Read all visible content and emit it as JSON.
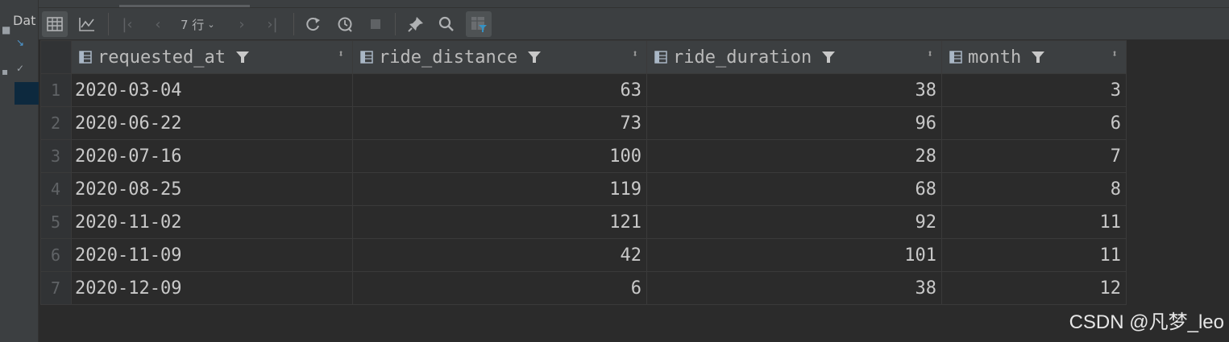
{
  "left_panel": {
    "truncated_label": "Dat"
  },
  "toolbar": {
    "rows_label": "7 行",
    "icons": [
      "table-view-icon",
      "chart-view-icon",
      "first-page-icon",
      "prev-page-icon",
      "next-page-icon",
      "last-page-icon",
      "refresh-icon",
      "history-icon",
      "stop-icon",
      "pin-icon",
      "search-icon",
      "filter-toggle-icon"
    ]
  },
  "table": {
    "columns": [
      {
        "label": "requested_at",
        "align": "left"
      },
      {
        "label": "ride_distance",
        "align": "right"
      },
      {
        "label": "ride_duration",
        "align": "right"
      },
      {
        "label": "month",
        "align": "right"
      }
    ],
    "rows": [
      {
        "n": "1",
        "requested_at": "2020-03-04",
        "ride_distance": "63",
        "ride_duration": "38",
        "month": "3"
      },
      {
        "n": "2",
        "requested_at": "2020-06-22",
        "ride_distance": "73",
        "ride_duration": "96",
        "month": "6"
      },
      {
        "n": "3",
        "requested_at": "2020-07-16",
        "ride_distance": "100",
        "ride_duration": "28",
        "month": "7"
      },
      {
        "n": "4",
        "requested_at": "2020-08-25",
        "ride_distance": "119",
        "ride_duration": "68",
        "month": "8"
      },
      {
        "n": "5",
        "requested_at": "2020-11-02",
        "ride_distance": "121",
        "ride_duration": "92",
        "month": "11"
      },
      {
        "n": "6",
        "requested_at": "2020-11-09",
        "ride_distance": "42",
        "ride_duration": "101",
        "month": "11"
      },
      {
        "n": "7",
        "requested_at": "2020-12-09",
        "ride_distance": "6",
        "ride_duration": "38",
        "month": "12"
      }
    ]
  },
  "watermark": "CSDN @凡梦_leo",
  "colors": {
    "background": "#2b2b2b",
    "toolbar": "#3c3f41",
    "filter_accent": "#3592c4"
  }
}
